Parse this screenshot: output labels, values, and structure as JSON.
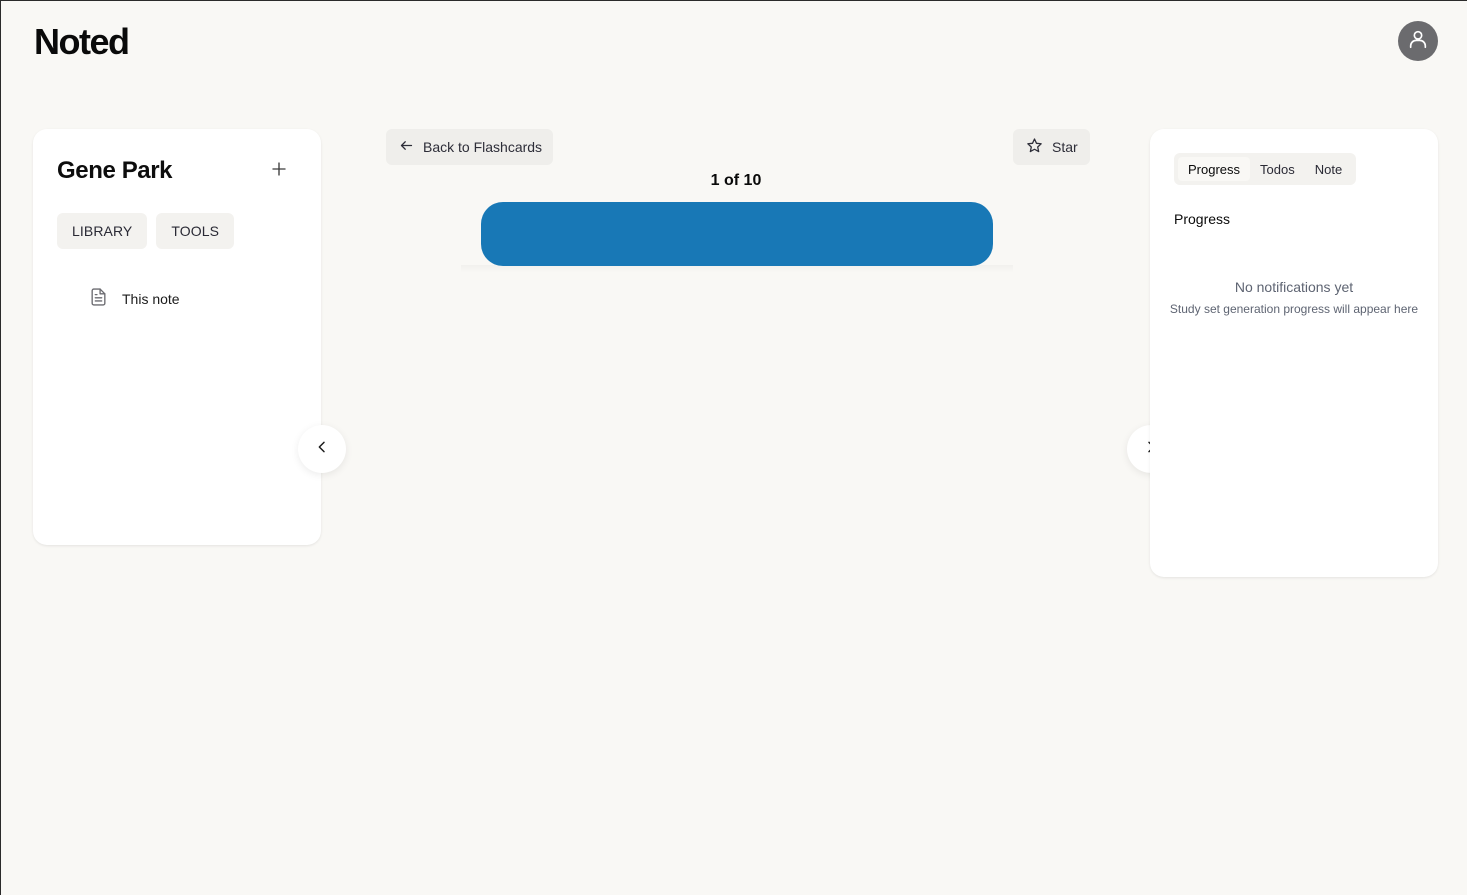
{
  "app": {
    "logo": "Noted"
  },
  "header": {
    "avatar_icon": "user-icon"
  },
  "sidebar": {
    "user_name": "Gene Park",
    "add_icon": "plus-icon",
    "buttons": [
      {
        "label": "LIBRARY"
      },
      {
        "label": "TOOLS"
      }
    ],
    "items": [
      {
        "label": "This note",
        "icon": "document-icon"
      }
    ]
  },
  "flashcards": {
    "back_label": "Back to Flashcards",
    "star_label": "Star",
    "counter": "1 of 10",
    "current": 1,
    "total": 10,
    "card_color": "#1878b6",
    "prev_icon": "chevron-left-icon",
    "next_icon": "chevron-right-icon"
  },
  "right_panel": {
    "tabs": [
      {
        "label": "Progress",
        "active": true
      },
      {
        "label": "Todos",
        "active": false
      },
      {
        "label": "Note",
        "active": false
      }
    ],
    "heading": "Progress",
    "empty_title": "No notifications yet",
    "empty_subtitle": "Study set generation progress will appear here"
  }
}
